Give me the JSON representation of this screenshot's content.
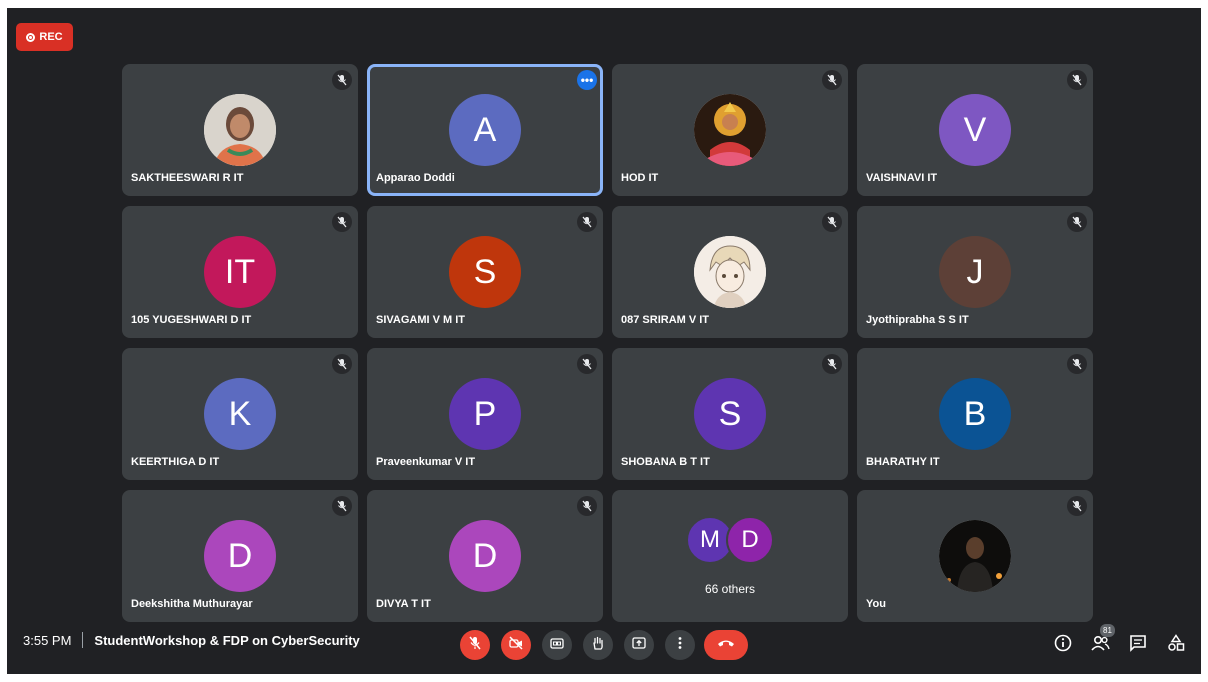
{
  "recording": {
    "label": "REC"
  },
  "participants": [
    {
      "name": "SAKTHEESWARI R IT",
      "avatar_type": "photo",
      "photo_icon": "woman-portrait-photo",
      "muted": true
    },
    {
      "name": "Apparao Doddi",
      "initial": "A",
      "avatar_color": "#5c6bc0",
      "muted": false,
      "speaking": true
    },
    {
      "name": "HOD IT",
      "avatar_type": "photo",
      "photo_icon": "goddess-image-photo",
      "muted": true
    },
    {
      "name": "VAISHNAVI IT",
      "initial": "V",
      "avatar_color": "#7e57c2",
      "muted": true
    },
    {
      "name": "105 YUGESHWARI D IT",
      "initial": "IT",
      "avatar_color": "#c2185b",
      "muted": true
    },
    {
      "name": "SIVAGAMI V M IT",
      "initial": "S",
      "avatar_color": "#bf360c",
      "muted": true
    },
    {
      "name": "087 SRIRAM V IT",
      "avatar_type": "photo",
      "photo_icon": "anime-sketch-photo",
      "muted": true
    },
    {
      "name": "Jyothiprabha S S IT",
      "initial": "J",
      "avatar_color": "#5d4037",
      "muted": true
    },
    {
      "name": "KEERTHIGA D IT",
      "initial": "K",
      "avatar_color": "#5c6bc0",
      "muted": true
    },
    {
      "name": "Praveenkumar V IT",
      "initial": "P",
      "avatar_color": "#5e35b1",
      "muted": true
    },
    {
      "name": "SHOBANA B T IT",
      "initial": "S",
      "avatar_color": "#5e35b1",
      "muted": true
    },
    {
      "name": "BHARATHY IT",
      "initial": "B",
      "avatar_color": "#0b5394",
      "muted": true
    },
    {
      "name": "Deekshitha Muthurayar",
      "initial": "D",
      "avatar_color": "#ab47bc",
      "muted": true
    },
    {
      "name": "DIVYA T IT",
      "initial": "D",
      "avatar_color": "#ab47bc",
      "muted": true
    }
  ],
  "others_tile": {
    "initials": [
      "M",
      "D"
    ],
    "colors": [
      "#5e35b1",
      "#8e24aa"
    ],
    "label": "66 others"
  },
  "self_tile": {
    "name": "You",
    "avatar_type": "photo",
    "photo_icon": "man-night-photo",
    "muted": true
  },
  "bottom_bar": {
    "time": "3:55 PM",
    "meeting_title": "StudentWorkshop & FDP on CyberSecurity",
    "participant_count": "81"
  },
  "colors": {
    "background": "#202124",
    "tile": "#3c4043",
    "danger": "#ea4335",
    "active_border": "#8ab4f8",
    "accent": "#1a73e8"
  }
}
